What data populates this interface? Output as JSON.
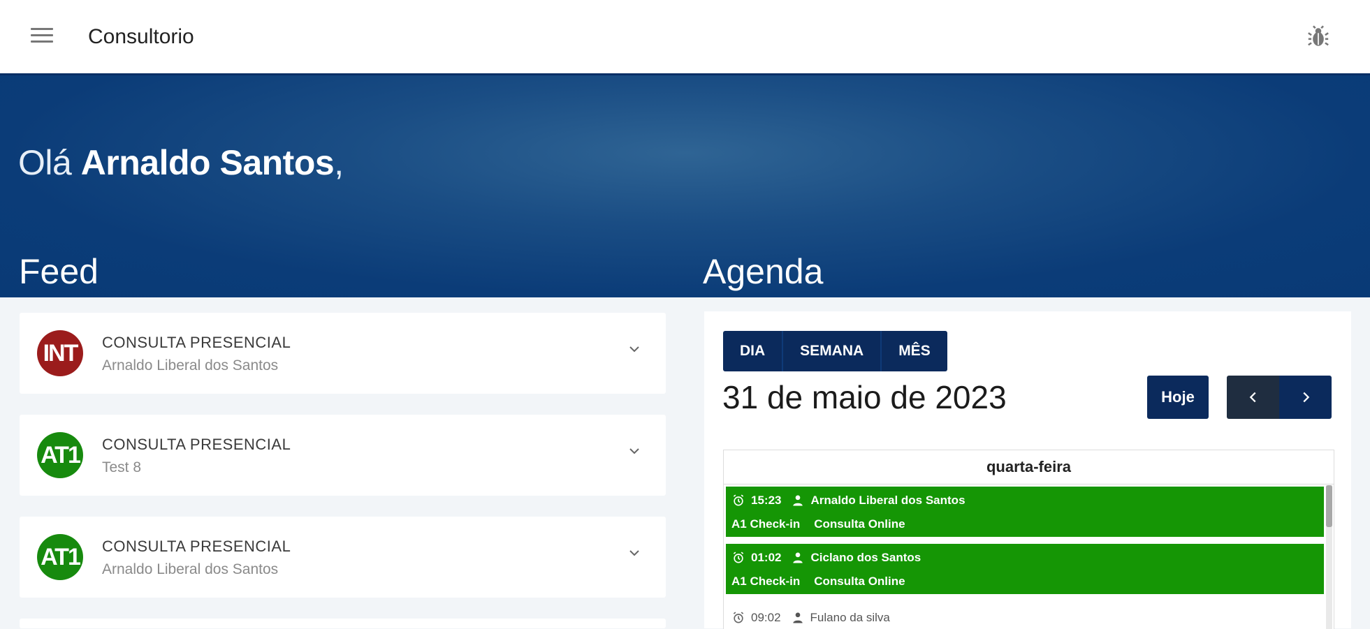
{
  "app": {
    "title": "Consultorio"
  },
  "greeting": {
    "prefix": "Olá ",
    "name": "Arnaldo Santos",
    "suffix": ","
  },
  "sections": {
    "feed": "Feed",
    "agenda": "Agenda"
  },
  "feed": {
    "items": [
      {
        "avatar": "INT",
        "avatar_color": "#9b1c1c",
        "type": "CONSULTA PRESENCIAL",
        "name": "Arnaldo Liberal dos Santos"
      },
      {
        "avatar": "AT1",
        "avatar_color": "#178a0e",
        "type": "CONSULTA PRESENCIAL",
        "name": "Test 8"
      },
      {
        "avatar": "AT1",
        "avatar_color": "#178a0e",
        "type": "CONSULTA PRESENCIAL",
        "name": "Arnaldo Liberal dos Santos"
      }
    ]
  },
  "agenda": {
    "views": {
      "day": "DIA",
      "week": "SEMANA",
      "month": "MÊS"
    },
    "date": "31 de maio de 2023",
    "today": "Hoje",
    "weekday": "quarta-feira",
    "events": [
      {
        "time": "15:23",
        "person": "Arnaldo Liberal dos Santos",
        "status": "A1 Check-in",
        "type": "Consulta Online",
        "color": "#159605"
      },
      {
        "time": "01:02",
        "person": "Ciclano dos Santos",
        "status": "A1 Check-in",
        "type": "Consulta Online",
        "color": "#159605"
      },
      {
        "time": "09:02",
        "person": "Fulano da silva"
      }
    ]
  },
  "colors": {
    "primary": "#0b2a5c",
    "hero": "#0b3c78",
    "success": "#159605"
  },
  "icons": {
    "menu": "menu-icon",
    "bug": "bug-icon",
    "expand": "chevron-down-icon",
    "alarm": "alarm-clock-icon",
    "person": "person-icon"
  }
}
